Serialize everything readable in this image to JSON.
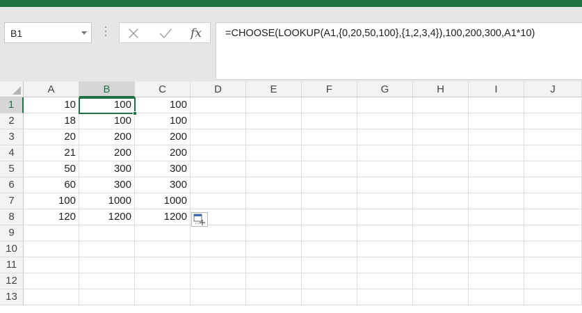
{
  "name_box": {
    "value": "B1"
  },
  "formula_bar": {
    "cancel_icon": "x-icon",
    "enter_icon": "check-icon",
    "fx_label": "fx",
    "formula": "=CHOOSE(LOOKUP(A1,{0,20,50,100},{1,2,3,4}),100,200,300,A1*10)"
  },
  "columns": [
    "A",
    "B",
    "C",
    "D",
    "E",
    "F",
    "G",
    "H",
    "I",
    "J"
  ],
  "rows": [
    "1",
    "2",
    "3",
    "4",
    "5",
    "6",
    "7",
    "8",
    "9",
    "10",
    "11",
    "12",
    "13"
  ],
  "selected": {
    "column": "B",
    "row": "1"
  },
  "cells": {
    "A": [
      "10",
      "18",
      "20",
      "21",
      "50",
      "60",
      "100",
      "120"
    ],
    "B": [
      "100",
      "100",
      "200",
      "200",
      "300",
      "300",
      "1000",
      "1200"
    ],
    "C": [
      "100",
      "100",
      "200",
      "200",
      "300",
      "300",
      "1000",
      "1200"
    ]
  },
  "colors": {
    "accent": "#217346",
    "header_bg": "#f3f3f3",
    "gridline": "#dcdcdc"
  }
}
